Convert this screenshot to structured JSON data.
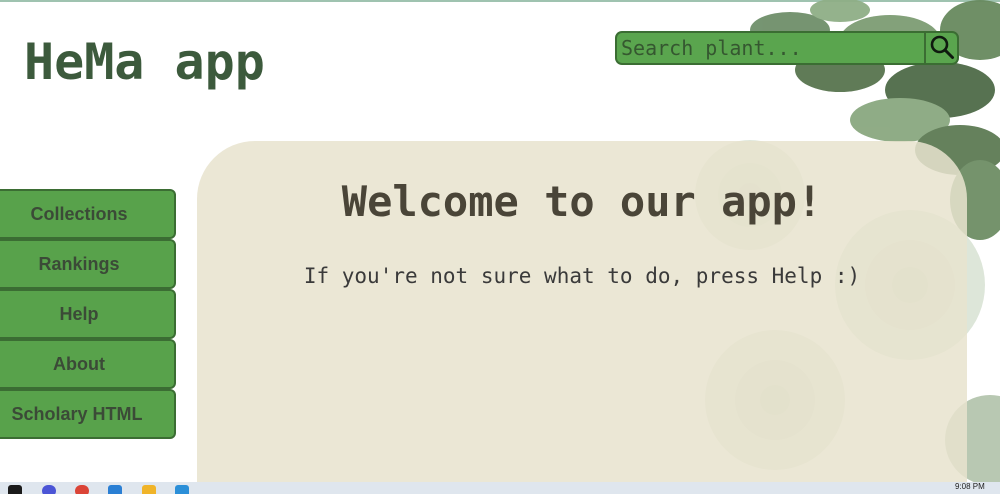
{
  "header": {
    "title": "HeMa app"
  },
  "search": {
    "placeholder": "Search plant...",
    "button_icon": "search-icon"
  },
  "sidebar": {
    "items": [
      {
        "label": "Collections"
      },
      {
        "label": "Rankings"
      },
      {
        "label": "Help"
      },
      {
        "label": "About"
      },
      {
        "label": "Scholary HTML"
      }
    ]
  },
  "main": {
    "title": "Welcome to our app!",
    "subtitle": "If you're not sure what to do, press Help :)"
  },
  "taskbar": {
    "clock": "9:08 PM",
    "icons": [
      "windows-start-icon",
      "app-icon",
      "chrome-icon",
      "vscode-icon",
      "file-explorer-icon",
      "store-icon"
    ]
  },
  "colors": {
    "accent_green": "#58a24b",
    "dark_green": "#3b6d33",
    "title_green": "#3c5a3c",
    "panel_beige": "#e8e3ce"
  }
}
